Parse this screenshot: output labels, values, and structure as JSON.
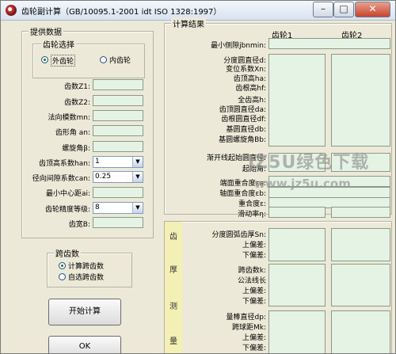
{
  "window": {
    "title": "齿轮副计算（GB/10095.1-2001 idt ISO 1328:1997）"
  },
  "input": {
    "legend": "提供数据",
    "gear_select": {
      "legend": "齿轮选择",
      "options": [
        "外齿轮",
        "内齿轮"
      ],
      "selected": 0
    },
    "labels": [
      "齿数Z1:",
      "齿数Z2:",
      "法向模数mn:",
      "齿形角 an:",
      "螺旋角β:",
      "齿顶高系数han:",
      "径向间隙系数can:",
      "最小中心距ai:",
      "齿轮精度等级:",
      "齿宽B:"
    ],
    "han_value": "1",
    "can_value": "0.25",
    "grade_value": "8"
  },
  "span": {
    "legend": "跨齿数",
    "options": [
      "计算跨齿数",
      "自选跨齿数"
    ],
    "selected": 0
  },
  "buttons": {
    "start": "开始计算",
    "ok": "OK"
  },
  "results": {
    "legend": "计算结果",
    "col1": "齿轮1",
    "col2": "齿轮2",
    "min_backlash": "最小侧隙jbnmin:",
    "rows1": [
      "分度圆直径d:",
      "变位系数Xn:",
      "齿顶高ha:",
      "齿根高hf:",
      "全齿高h:",
      "齿顶圆直径da:",
      "齿根圆直径df:",
      "基圆直径db:",
      "基圆螺旋角Bb:"
    ],
    "rows2": [
      "渐开线起始圆直径:",
      "起始角:",
      "端面重合度εa:",
      "轴面重合度εb:",
      "重合度ε:",
      "滑动率η:"
    ]
  },
  "thickness": {
    "vertical": [
      "齿",
      "厚",
      "测",
      "量"
    ],
    "group1": [
      "分度圆弧齿厚Sn:",
      "上偏差:",
      "下偏差:"
    ],
    "group2": [
      "跨齿数k:",
      "公法线长",
      "上偏差:",
      "下偏差:"
    ],
    "group3": [
      "量棒直径dp:",
      "跨球距Mk:",
      "上偏差:",
      "下偏差:"
    ]
  },
  "watermark": {
    "line1": "JZ5U绿色下载",
    "line2": "www.jz5u.com"
  }
}
